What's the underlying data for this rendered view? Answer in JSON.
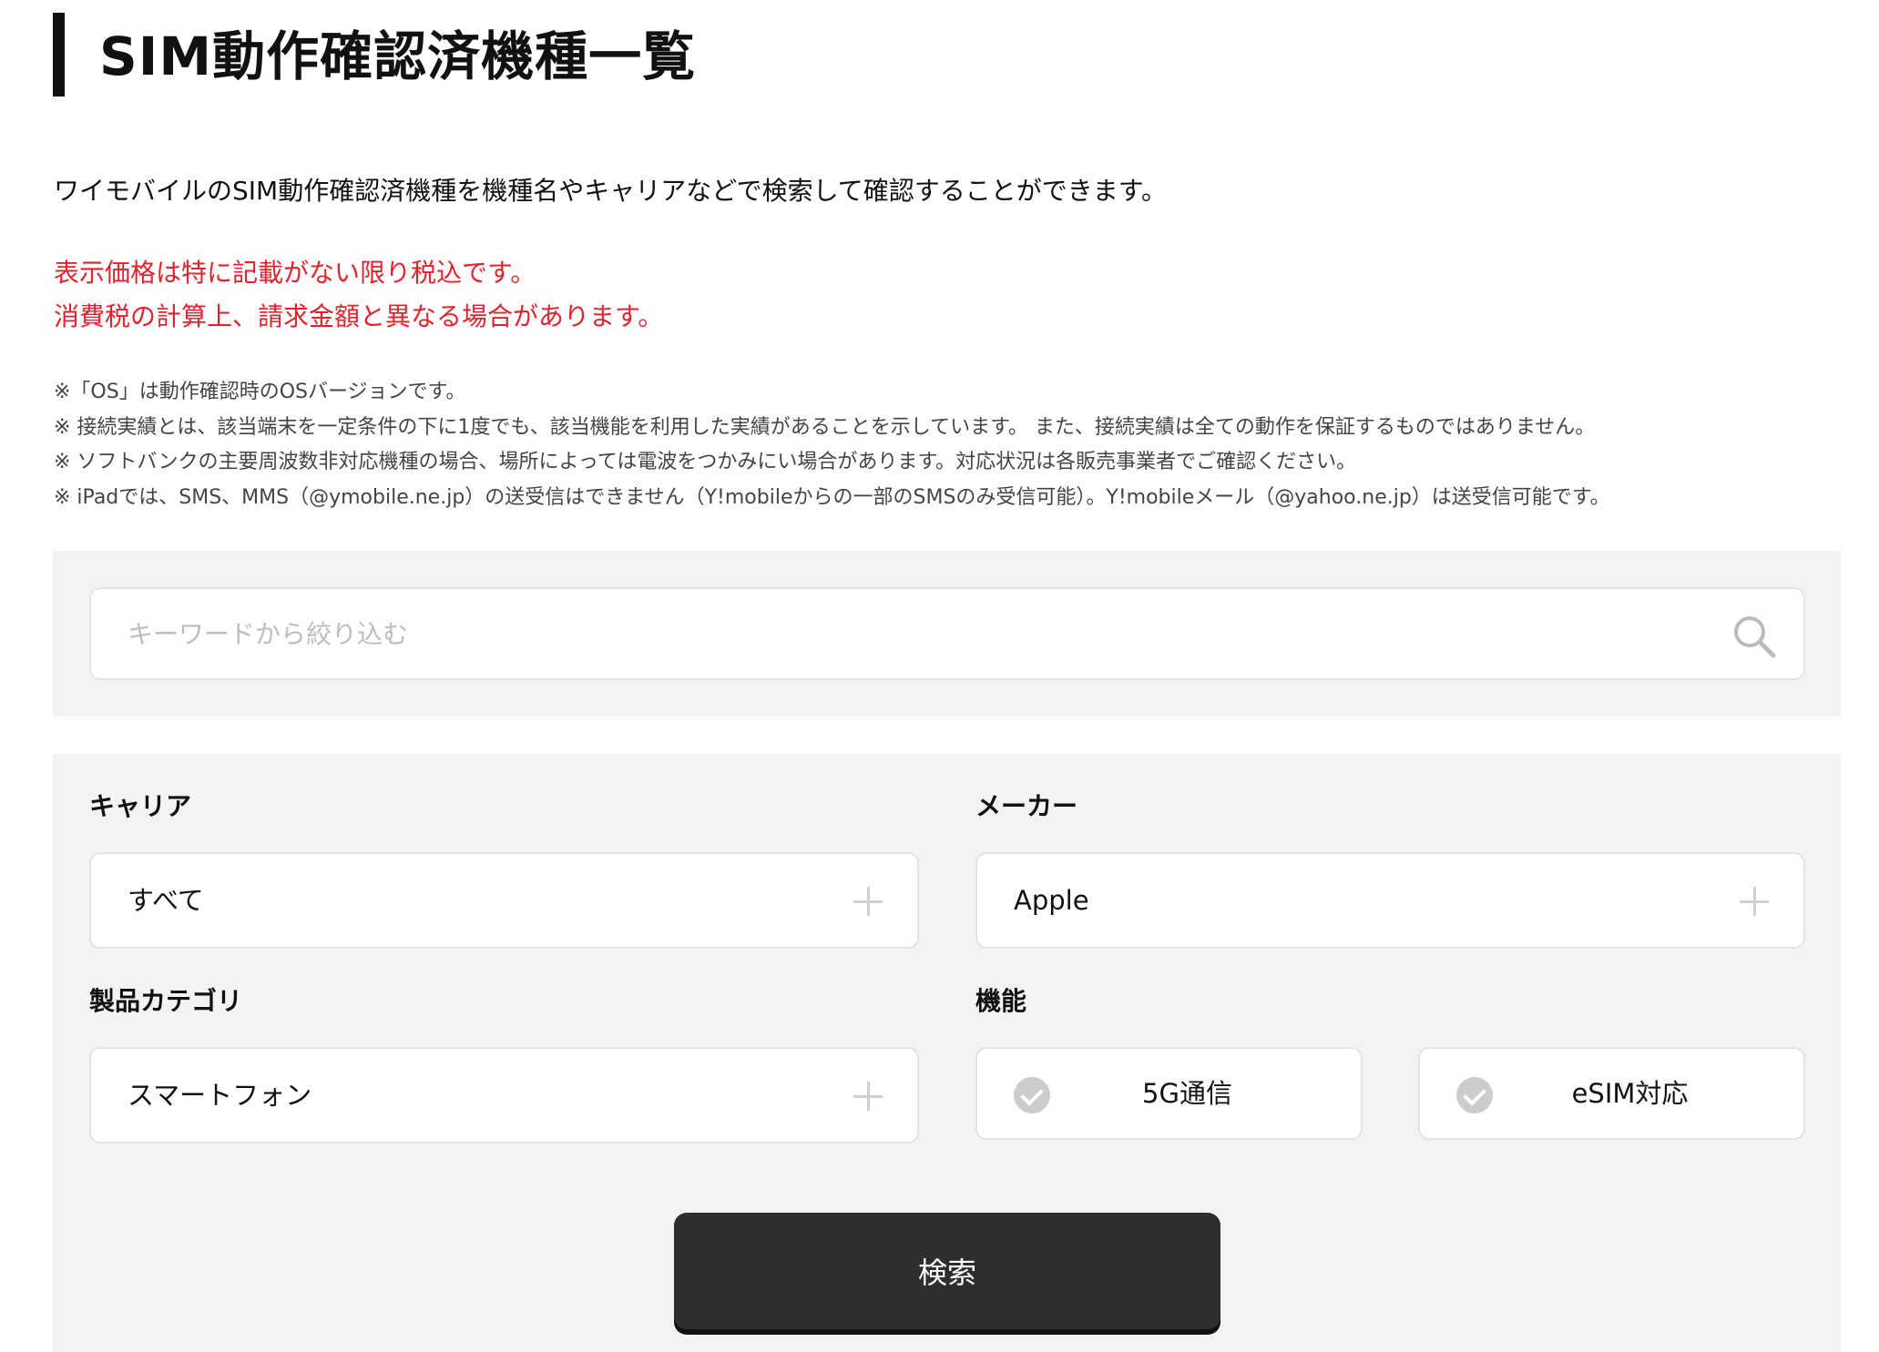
{
  "header": {
    "title": "SIM動作確認済機種一覧"
  },
  "intro": {
    "text": "ワイモバイルのSIM動作確認済機種を機種名やキャリアなどで検索して確認することができます。"
  },
  "notice": {
    "line1": "表示価格は特に記載がない限り税込です。",
    "line2": "消費税の計算上、請求金額と異なる場合があります。",
    "color": "#e4222e"
  },
  "notes": [
    "※「OS」は動作確認時のOSバージョンです。",
    "※ 接続実績とは、該当端末を一定条件の下に1度でも、該当機能を利用した実績があることを示しています。 また、接続実績は全ての動作を保証するものではありません。",
    "※ ソフトバンクの主要周波数非対応機種の場合、場所によっては電波をつかみにい場合があります。対応状況は各販売事業者でご確認ください。",
    "※ iPadでは、SMS、MMS（@ymobile.ne.jp）の送受信はできません（Y!mobileからの一部のSMSのみ受信可能）。Y!mobileメール（@yahoo.ne.jp）は送受信可能です。"
  ],
  "search": {
    "placeholder": "キーワードから絞り込む",
    "value": "",
    "icon": "search-icon"
  },
  "filters": {
    "carrier": {
      "label": "キャリア",
      "value": "すべて",
      "icon": "plus-icon"
    },
    "maker": {
      "label": "メーカー",
      "value": "Apple",
      "icon": "plus-icon"
    },
    "category": {
      "label": "製品カテゴリ",
      "value": "スマートフォン",
      "icon": "plus-icon"
    },
    "features": {
      "label": "機能",
      "options": [
        {
          "label": "5G通信",
          "checked": false,
          "icon": "check-circle-icon"
        },
        {
          "label": "eSIM対応",
          "checked": false,
          "icon": "check-circle-icon"
        }
      ]
    }
  },
  "submit": {
    "label": "検索",
    "color": "#2e2e2e"
  }
}
